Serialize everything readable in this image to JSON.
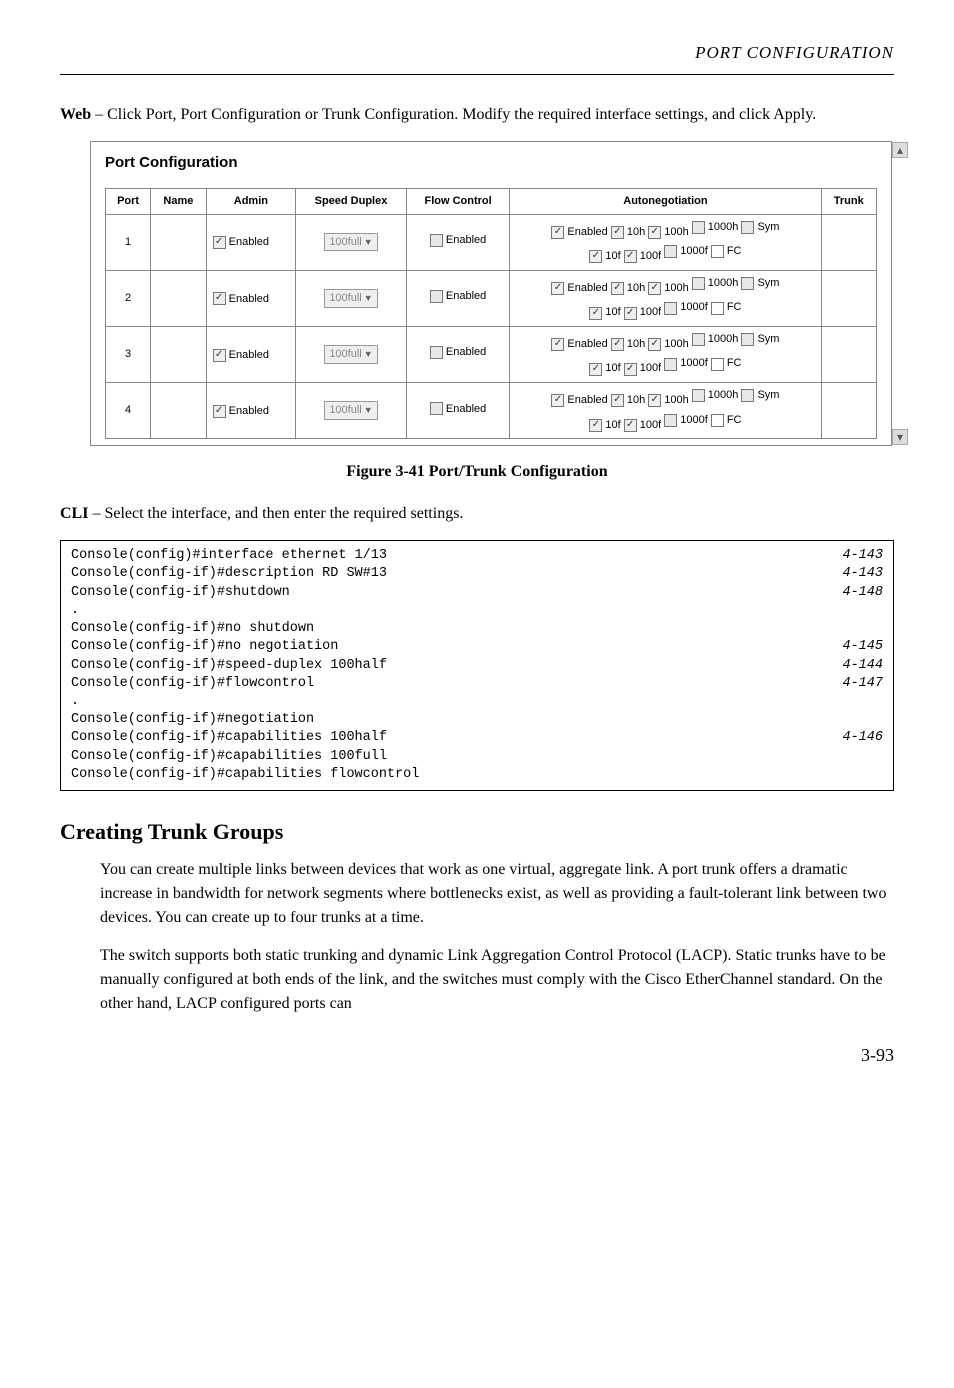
{
  "running_head": "PORT CONFIGURATION",
  "intro": {
    "strong": "Web",
    "text": " – Click Port, Port Configuration or Trunk Configuration. Modify the required interface settings, and click Apply."
  },
  "screenshot": {
    "title": "Port Configuration",
    "headers": {
      "port": "Port",
      "name": "Name",
      "admin": "Admin",
      "speed": "Speed Duplex",
      "flow": "Flow Control",
      "auton": "Autonegotiation",
      "trunk": "Trunk"
    },
    "enabled_label": "Enabled",
    "sel_label": "100full",
    "auton_row1": [
      "Enabled",
      "10h",
      "100h",
      "1000h",
      "Sym"
    ],
    "auton_row2": [
      "10f",
      "100f",
      "1000f",
      "FC"
    ],
    "rows": [
      1,
      2,
      3,
      4
    ]
  },
  "figcaption": "Figure 3-41  Port/Trunk Configuration",
  "cli_intro": {
    "strong": "CLI",
    "text": " – Select the interface, and then enter the required settings."
  },
  "code": [
    {
      "t": "Console(config)#interface ethernet 1/13",
      "r": "4-143"
    },
    {
      "t": "Console(config-if)#description RD SW#13",
      "r": "4-143"
    },
    {
      "t": "Console(config-if)#shutdown",
      "r": "4-148"
    },
    {
      "t": ".",
      "r": ""
    },
    {
      "t": "Console(config-if)#no shutdown",
      "r": ""
    },
    {
      "t": "Console(config-if)#no negotiation",
      "r": "4-145"
    },
    {
      "t": "Console(config-if)#speed-duplex 100half",
      "r": "4-144"
    },
    {
      "t": "Console(config-if)#flowcontrol",
      "r": "4-147"
    },
    {
      "t": ".",
      "r": ""
    },
    {
      "t": "Console(config-if)#negotiation",
      "r": ""
    },
    {
      "t": "Console(config-if)#capabilities 100half",
      "r": "4-146"
    },
    {
      "t": "Console(config-if)#capabilities 100full",
      "r": ""
    },
    {
      "t": "Console(config-if)#capabilities flowcontrol",
      "r": ""
    }
  ],
  "section_title": "Creating Trunk Groups",
  "para1": "You can create multiple links between devices that work as one virtual, aggregate link. A port trunk offers a dramatic increase in bandwidth for network segments where bottlenecks exist, as well as providing a fault-tolerant link between two devices. You can create up to four trunks at a time.",
  "para2": "The switch supports both static trunking and dynamic Link Aggregation Control Protocol (LACP). Static trunks have to be manually configured at both ends of the link, and the switches must comply with the Cisco EtherChannel standard. On the other hand, LACP configured ports can",
  "page_num": "3-93"
}
